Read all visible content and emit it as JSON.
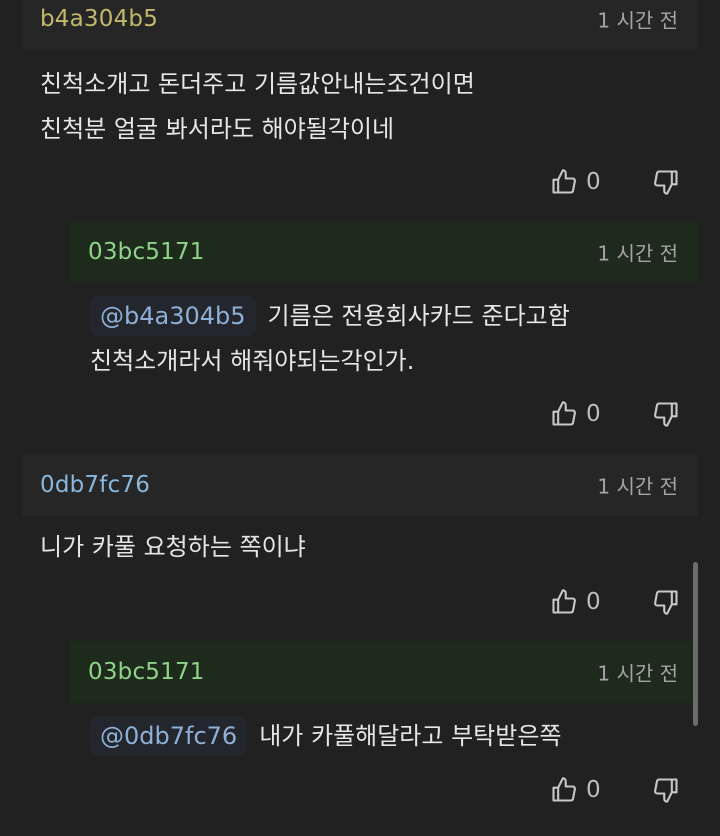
{
  "colors": {
    "background": "#212121",
    "username_1": "#c2b86a",
    "username_reply": "#8fd28a",
    "username_3": "#8ab7dc",
    "mention": "#8fb0d6"
  },
  "comments": [
    {
      "username": "b4a304b5",
      "time": "1 시간 전",
      "line1": "친척소개고 돈더주고 기름값안내는조건이면",
      "line2": "친척분 얼굴 봐서라도 해야될각이네",
      "likes": "0"
    },
    {
      "username": "03bc5171",
      "time": "1 시간 전",
      "mention": "@b4a304b5",
      "line1": "기름은 전용회사카드 준다고함",
      "line2": "친척소개라서 해줘야되는각인가.",
      "likes": "0"
    },
    {
      "username": "0db7fc76",
      "time": "1 시간 전",
      "line1": "니가 카풀 요청하는 쪽이냐",
      "likes": "0"
    },
    {
      "username": "03bc5171",
      "time": "1 시간 전",
      "mention": "@0db7fc76",
      "line1": "내가 카풀해달라고 부탁받은쪽",
      "likes": "0"
    }
  ],
  "icons": {
    "like": "thumbs-up-icon",
    "dislike": "thumbs-down-icon"
  }
}
